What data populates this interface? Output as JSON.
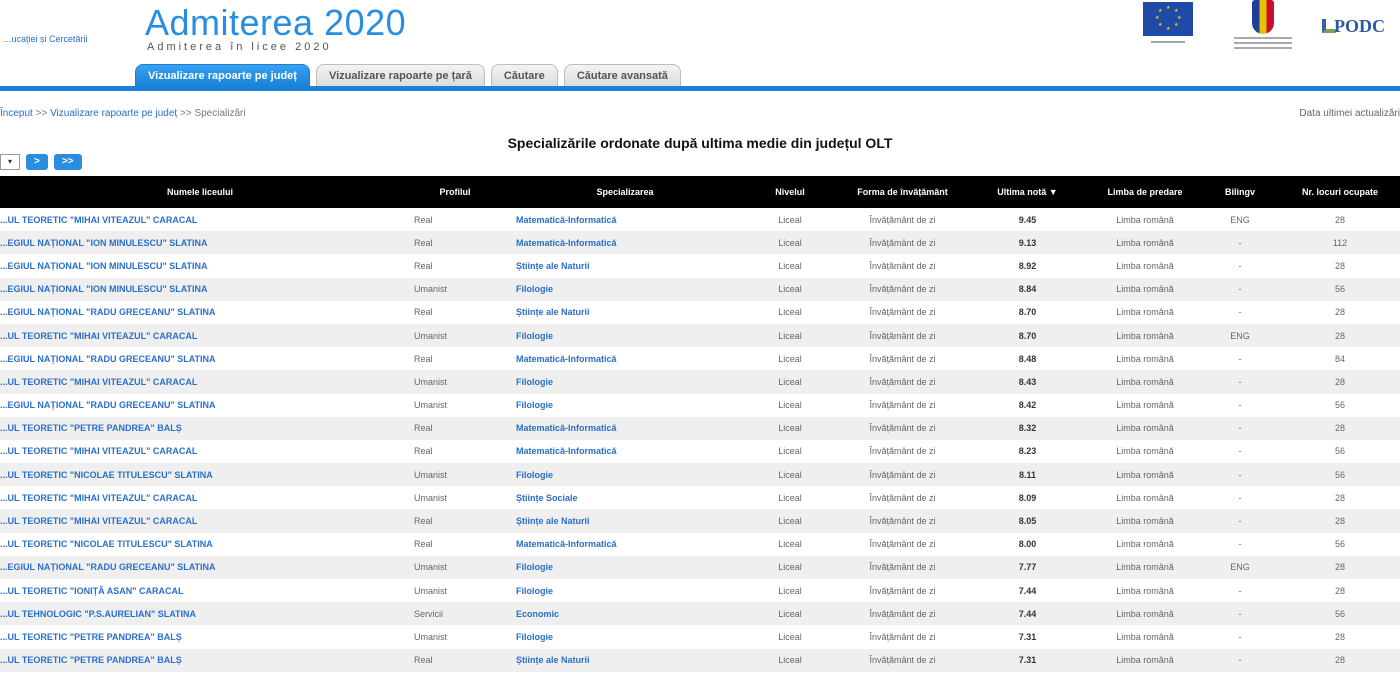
{
  "header": {
    "ministry_link": "...ucației și Cercetării",
    "title": "Admiterea 2020",
    "subtitle": "Admiterea în licee 2020",
    "logos": [
      "eu-flag-icon",
      "romania-government-crest-icon",
      "podca-logo"
    ],
    "podca_text": "PODC"
  },
  "tabs": [
    {
      "label": "Vizualizare rapoarte pe județ",
      "active": true
    },
    {
      "label": "Vizualizare rapoarte pe țară",
      "active": false
    },
    {
      "label": "Căutare",
      "active": false
    },
    {
      "label": "Căutare avansată",
      "active": false
    }
  ],
  "breadcrumb": {
    "home": "Început",
    "sep": ">>",
    "reports": "Vizualizare rapoarte pe județ",
    "current": "Specializări"
  },
  "update_note": "Data ultimei actualizări",
  "page_title": "Specializările ordonate după ultima medie din județul OLT",
  "pager": {
    "select_value": "",
    "next": ">",
    "last": ">>"
  },
  "table": {
    "columns": [
      "Numele liceului",
      "Profilul",
      "Specializarea",
      "Nivelul",
      "Forma de învățământ",
      "Ultima notă ▼",
      "Limba de predare",
      "Bilingv",
      "Nr. locuri ocupate"
    ],
    "rows": [
      [
        "...UL TEORETIC \"MIHAI VITEAZUL\" CARACAL",
        "Real",
        "Matematică-Informatică",
        "Liceal",
        "Învățământ de zi",
        "9.45",
        "Limba română",
        "ENG",
        "28"
      ],
      [
        "...EGIUL NAȚIONAL \"ION MINULESCU\" SLATINA",
        "Real",
        "Matematică-Informatică",
        "Liceal",
        "Învățământ de zi",
        "9.13",
        "Limba română",
        "-",
        "112"
      ],
      [
        "...EGIUL NAȚIONAL \"ION MINULESCU\" SLATINA",
        "Real",
        "Științe ale Naturii",
        "Liceal",
        "Învățământ de zi",
        "8.92",
        "Limba română",
        "-",
        "28"
      ],
      [
        "...EGIUL NAȚIONAL \"ION MINULESCU\" SLATINA",
        "Umanist",
        "Filologie",
        "Liceal",
        "Învățământ de zi",
        "8.84",
        "Limba română",
        "-",
        "56"
      ],
      [
        "...EGIUL NAȚIONAL \"RADU GRECEANU\" SLATINA",
        "Real",
        "Științe ale Naturii",
        "Liceal",
        "Învățământ de zi",
        "8.70",
        "Limba română",
        "-",
        "28"
      ],
      [
        "...UL TEORETIC \"MIHAI VITEAZUL\" CARACAL",
        "Umanist",
        "Filologie",
        "Liceal",
        "Învățământ de zi",
        "8.70",
        "Limba română",
        "ENG",
        "28"
      ],
      [
        "...EGIUL NAȚIONAL \"RADU GRECEANU\" SLATINA",
        "Real",
        "Matematică-Informatică",
        "Liceal",
        "Învățământ de zi",
        "8.48",
        "Limba română",
        "-",
        "84"
      ],
      [
        "...UL TEORETIC \"MIHAI VITEAZUL\" CARACAL",
        "Umanist",
        "Filologie",
        "Liceal",
        "Învățământ de zi",
        "8.43",
        "Limba română",
        "-",
        "28"
      ],
      [
        "...EGIUL NAȚIONAL \"RADU GRECEANU\" SLATINA",
        "Umanist",
        "Filologie",
        "Liceal",
        "Învățământ de zi",
        "8.42",
        "Limba română",
        "-",
        "56"
      ],
      [
        "...UL TEORETIC \"PETRE PANDREA\" BALȘ",
        "Real",
        "Matematică-Informatică",
        "Liceal",
        "Învățământ de zi",
        "8.32",
        "Limba română",
        "-",
        "28"
      ],
      [
        "...UL TEORETIC \"MIHAI VITEAZUL\" CARACAL",
        "Real",
        "Matematică-Informatică",
        "Liceal",
        "Învățământ de zi",
        "8.23",
        "Limba română",
        "-",
        "56"
      ],
      [
        "...UL TEORETIC \"NICOLAE TITULESCU\" SLATINA",
        "Umanist",
        "Filologie",
        "Liceal",
        "Învățământ de zi",
        "8.11",
        "Limba română",
        "-",
        "56"
      ],
      [
        "...UL TEORETIC \"MIHAI VITEAZUL\" CARACAL",
        "Umanist",
        "Științe Sociale",
        "Liceal",
        "Învățământ de zi",
        "8.09",
        "Limba română",
        "-",
        "28"
      ],
      [
        "...UL TEORETIC \"MIHAI VITEAZUL\" CARACAL",
        "Real",
        "Științe ale Naturii",
        "Liceal",
        "Învățământ de zi",
        "8.05",
        "Limba română",
        "-",
        "28"
      ],
      [
        "...UL TEORETIC \"NICOLAE TITULESCU\" SLATINA",
        "Real",
        "Matematică-Informatică",
        "Liceal",
        "Învățământ de zi",
        "8.00",
        "Limba română",
        "-",
        "56"
      ],
      [
        "...EGIUL NAȚIONAL \"RADU GRECEANU\" SLATINA",
        "Umanist",
        "Filologie",
        "Liceal",
        "Învățământ de zi",
        "7.77",
        "Limba română",
        "ENG",
        "28"
      ],
      [
        "...UL TEORETIC \"IONIȚĂ ASAN\" CARACAL",
        "Umanist",
        "Filologie",
        "Liceal",
        "Învățământ de zi",
        "7.44",
        "Limba română",
        "-",
        "28"
      ],
      [
        "...UL TEHNOLOGIC \"P.S.AURELIAN\" SLATINA",
        "Servicii",
        "Economic",
        "Liceal",
        "Învățământ de zi",
        "7.44",
        "Limba română",
        "-",
        "56"
      ],
      [
        "...UL TEORETIC \"PETRE PANDREA\" BALȘ",
        "Umanist",
        "Filologie",
        "Liceal",
        "Învățământ de zi",
        "7.31",
        "Limba română",
        "-",
        "28"
      ],
      [
        "...UL TEORETIC \"PETRE PANDREA\" BALȘ",
        "Real",
        "Științe ale Naturii",
        "Liceal",
        "Învățământ de zi",
        "7.31",
        "Limba română",
        "-",
        "28"
      ]
    ]
  },
  "colors": {
    "accent": "#1a82d8",
    "link": "#2a6fc9",
    "header_bg": "#000000",
    "stripe": "#efefef"
  }
}
